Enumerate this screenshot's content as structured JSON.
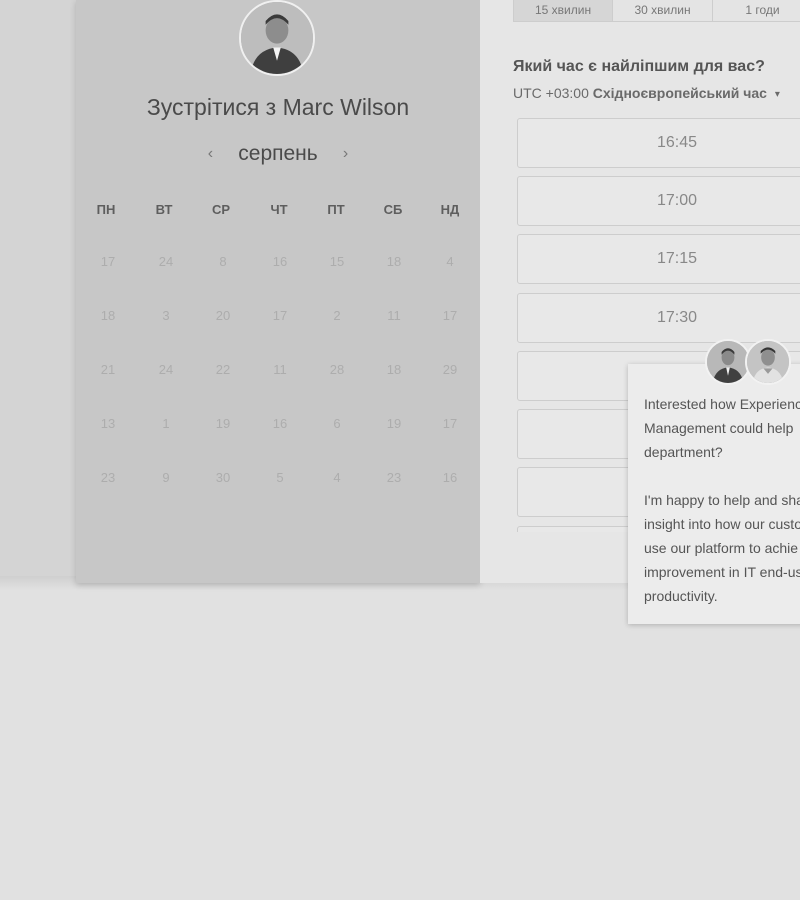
{
  "calendar": {
    "meet_title": "Зустрітися з Marc Wilson",
    "month": "серпень",
    "prev_arrow": "‹",
    "next_arrow": "›",
    "weekdays": [
      "ПН",
      "ВТ",
      "СР",
      "ЧТ",
      "ПТ",
      "СБ",
      "НД"
    ],
    "weeks": [
      [
        "17",
        "24",
        "8",
        "16",
        "15",
        "18",
        "4"
      ],
      [
        "18",
        "3",
        "20",
        "17",
        "2",
        "11",
        "17"
      ],
      [
        "21",
        "24",
        "22",
        "11",
        "28",
        "18",
        "29"
      ],
      [
        "13",
        "1",
        "19",
        "16",
        "6",
        "19",
        "17"
      ],
      [
        "23",
        "9",
        "30",
        "5",
        "4",
        "23",
        "16"
      ]
    ]
  },
  "scheduler": {
    "durations": [
      "15 хвилин",
      "30 хвилин",
      "1 годи"
    ],
    "question": "Який час є найліпшим для вас?",
    "tz_prefix": "UTC +03:00",
    "tz_name": "Східноєвропейський час",
    "tz_caret": "▾",
    "slots": [
      "16:45",
      "17:00",
      "17:15",
      "17:30",
      "",
      "",
      "",
      ""
    ]
  },
  "chat": {
    "lines_a": [
      "Interested how Experienc",
      "Management could help",
      "department?"
    ],
    "lines_b": [
      "I'm happy to help and sha",
      "insight into how our custo",
      "use our platform to achie",
      "improvement in IT end-us",
      "productivity."
    ]
  },
  "colors": {
    "page_bg": "#e1e1e1",
    "card_bg": "#c7c7c7",
    "panel_bg": "#e6e6e6"
  }
}
